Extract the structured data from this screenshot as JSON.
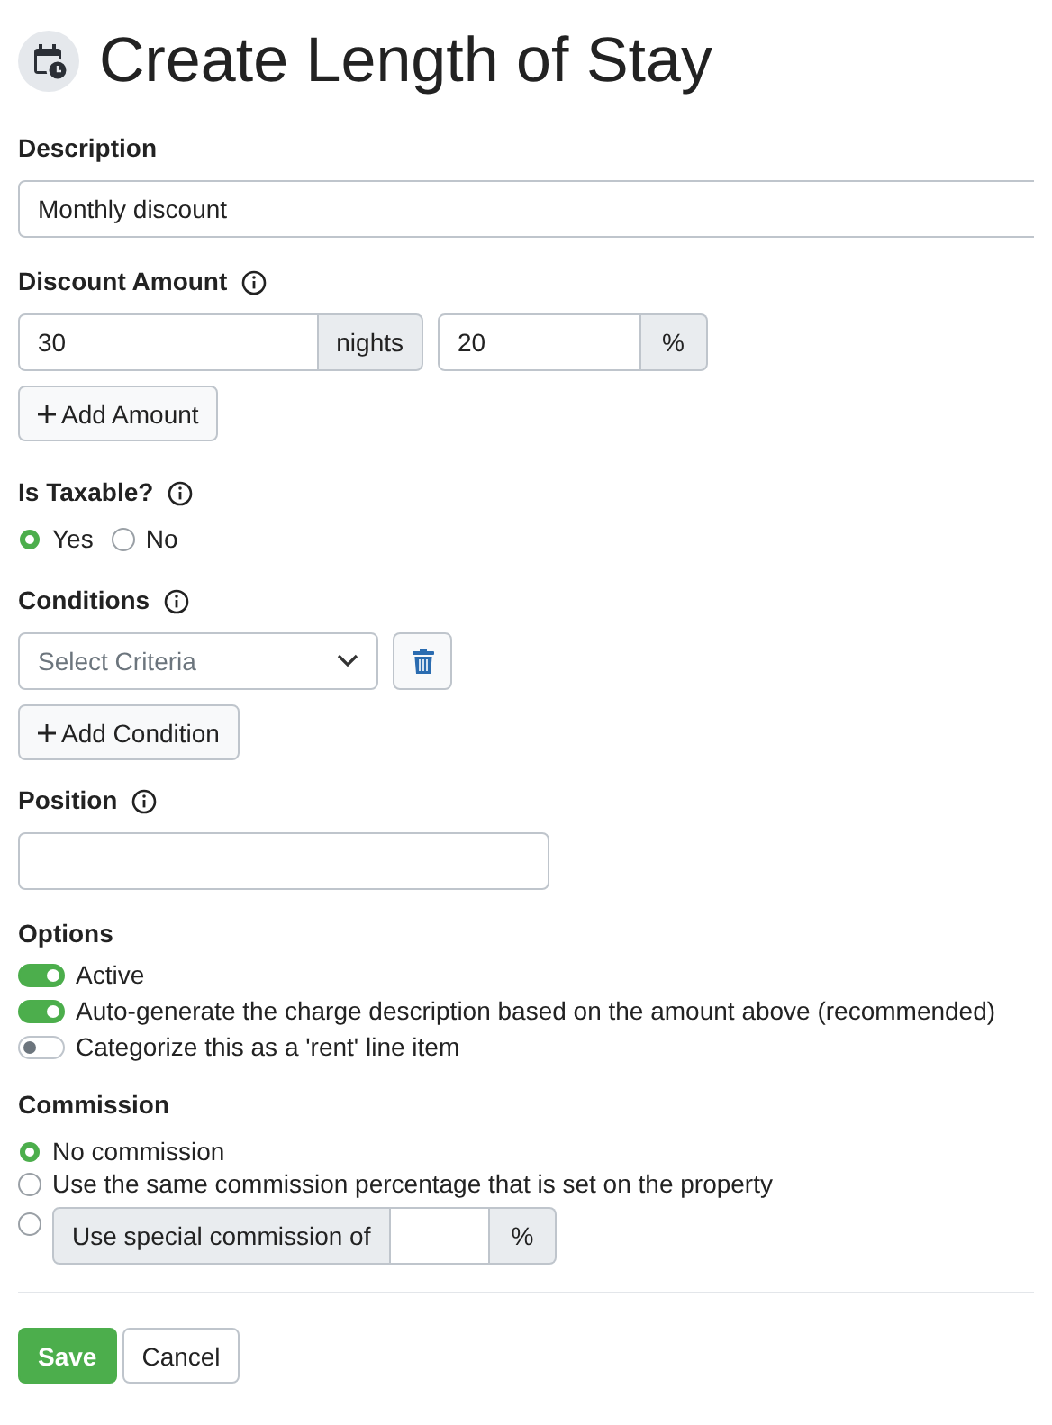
{
  "title": "Create Length of Stay",
  "description": {
    "label": "Description",
    "value": "Monthly discount"
  },
  "discount": {
    "label": "Discount Amount",
    "amount": {
      "value": "30",
      "addon": "nights"
    },
    "percent": {
      "value": "20",
      "addon": "%"
    },
    "add_button": "Add Amount"
  },
  "taxable": {
    "label": "Is Taxable?",
    "options": [
      {
        "label": "Yes",
        "selected": true
      },
      {
        "label": "No",
        "selected": false
      }
    ]
  },
  "conditions": {
    "label": "Conditions",
    "select": {
      "placeholder": "Select Criteria"
    },
    "add_button": "Add Condition"
  },
  "position": {
    "label": "Position"
  },
  "options": {
    "label": "Options",
    "items": [
      {
        "label": "Active",
        "on": true
      },
      {
        "label": "Auto-generate the charge description based on the amount above (recommended)",
        "on": true
      },
      {
        "label": "Categorize this as a 'rent' line item",
        "on": false
      }
    ]
  },
  "commission": {
    "label": "Commission",
    "items": [
      {
        "kind": "plain",
        "label": "No commission",
        "selected": true
      },
      {
        "kind": "plain",
        "label": "Use the same commission percentage that is set on the property",
        "selected": false
      },
      {
        "kind": "input",
        "label": "Use special commission of",
        "addon": "%",
        "selected": false
      }
    ]
  },
  "buttons": {
    "save": "Save",
    "cancel": "Cancel"
  }
}
